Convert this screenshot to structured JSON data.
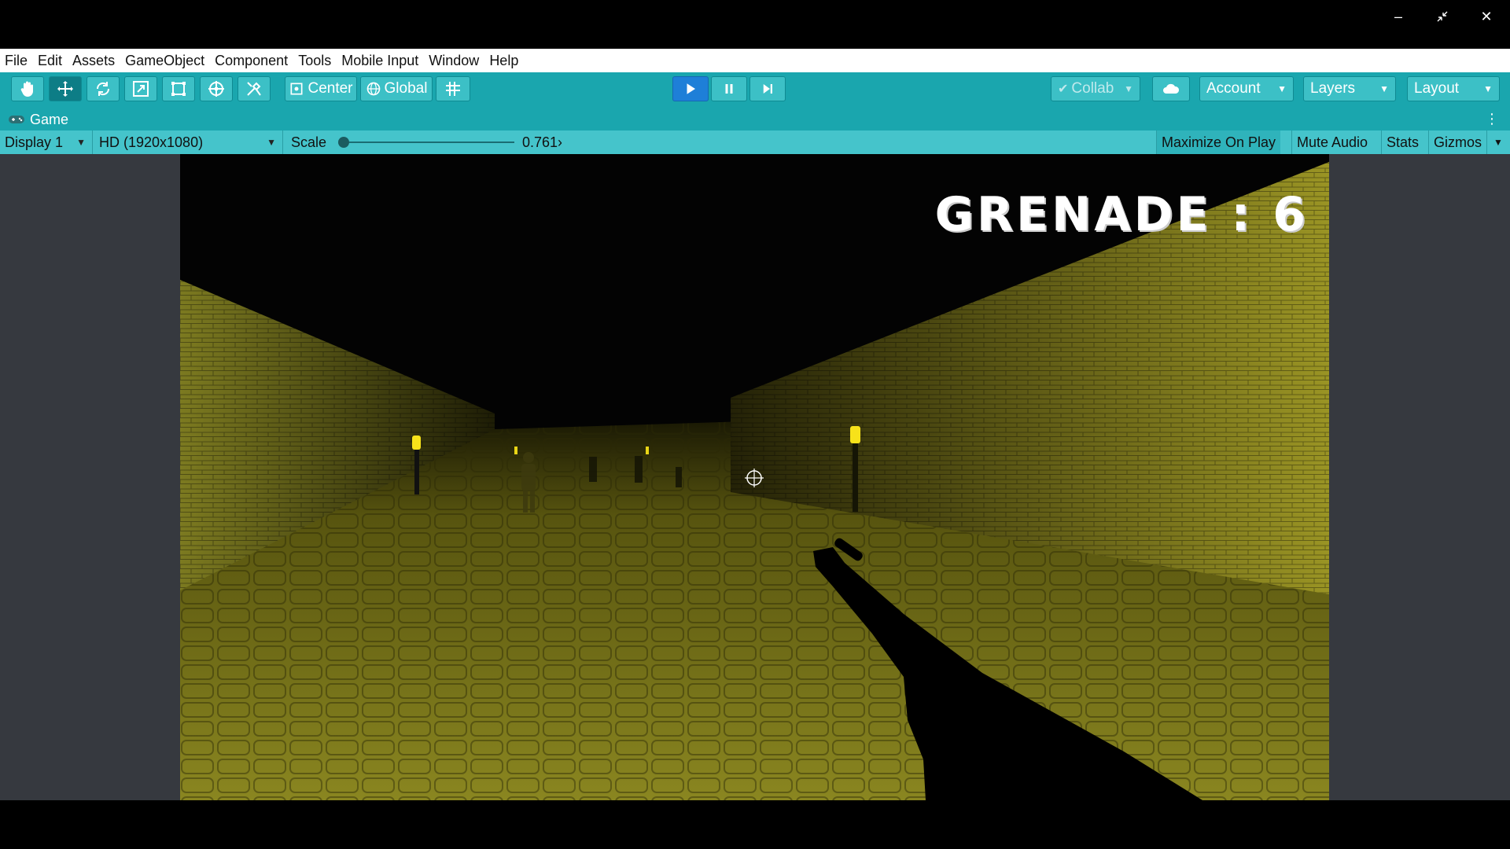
{
  "window": {
    "controls": [
      "minimize",
      "restore",
      "close"
    ]
  },
  "menu": {
    "items": [
      "File",
      "Edit",
      "Assets",
      "GameObject",
      "Component",
      "Tools",
      "Mobile Input",
      "Window",
      "Help"
    ]
  },
  "toolbar": {
    "tools": [
      "hand-tool",
      "move-tool",
      "rotate-tool",
      "scale-tool",
      "rect-tool",
      "transform-tool",
      "custom-tool"
    ],
    "active_tool": "move-tool",
    "pivot_mode": "Center",
    "pivot_rotation": "Global",
    "playback": [
      "play",
      "pause",
      "step"
    ],
    "play_active": true,
    "collab_label": "Collab",
    "account_label": "Account",
    "layers_label": "Layers",
    "layout_label": "Layout"
  },
  "game_tab": {
    "title": "Game"
  },
  "game_view": {
    "display": "Display 1",
    "resolution": "HD (1920x1080)",
    "scale_label": "Scale",
    "scale_value": "0.761›",
    "scale_fraction": 0.0,
    "buttons": {
      "maximize_on_play": "Maximize On Play",
      "mute_audio": "Mute Audio",
      "stats": "Stats",
      "gizmos": "Gizmos"
    }
  },
  "scene": {
    "hud_text": "GRENADE : 6",
    "colors": {
      "wall": "#8a8a1c",
      "floor": "#7d7a1a",
      "lamp": "#f7e21a"
    }
  }
}
